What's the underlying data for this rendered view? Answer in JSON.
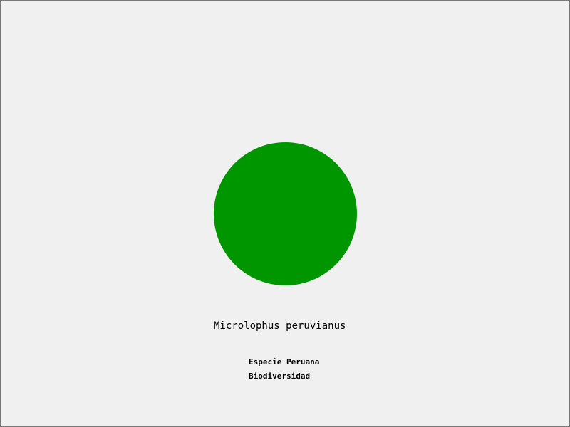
{
  "colors": {
    "background": "#f0f0f0",
    "circle": "#009600",
    "text": "#000000",
    "border": "#777777"
  },
  "species": {
    "name": "Microlophus peruvianus"
  },
  "labels": {
    "line1": "Especie Peruana",
    "line2": "Biodiversidad"
  }
}
